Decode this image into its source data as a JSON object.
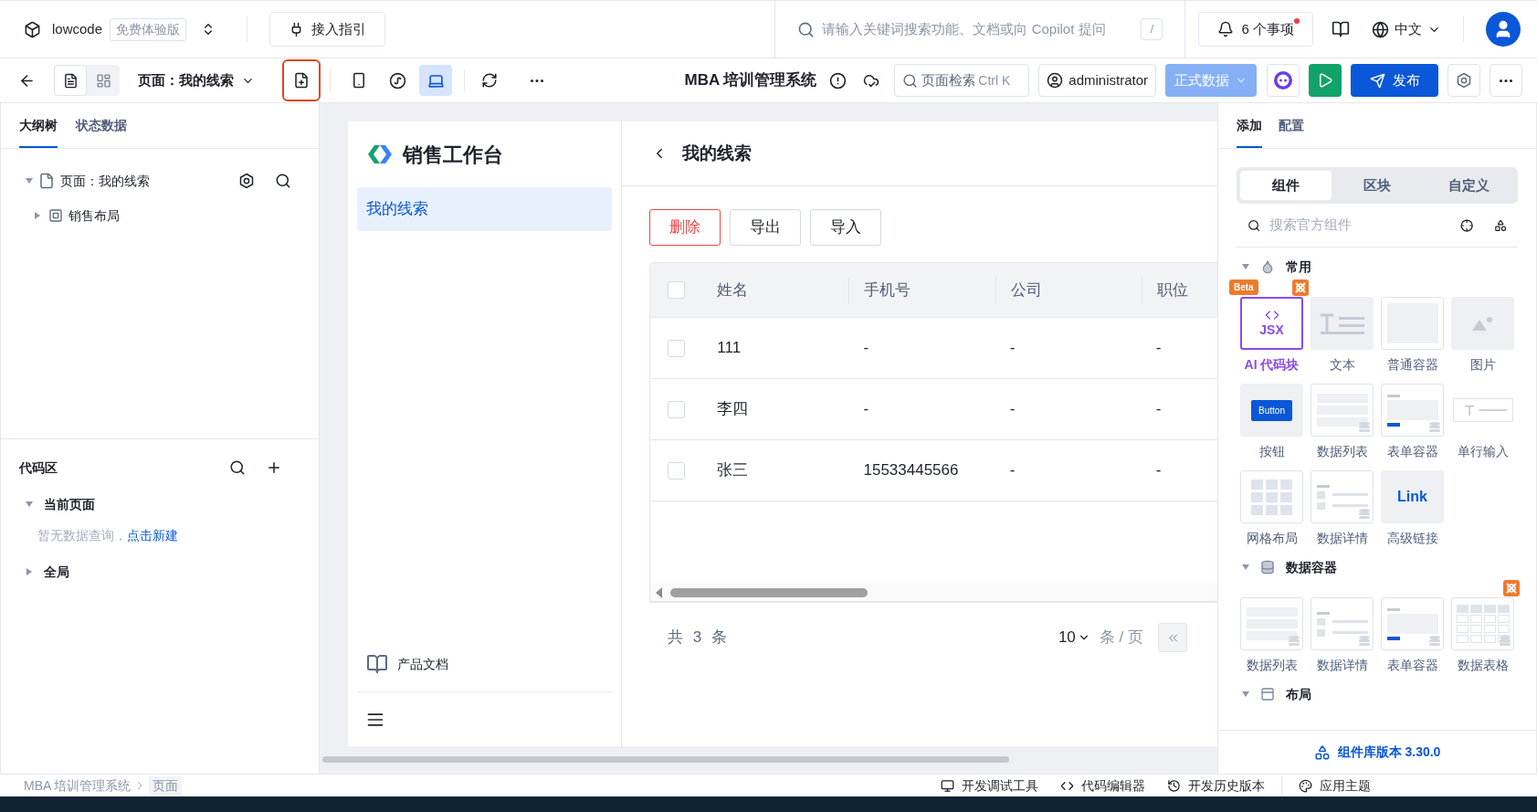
{
  "topbar": {
    "app_name": "lowcode",
    "plan_badge": "免费体验版",
    "guide_button": "接入指引",
    "search": {
      "placeholder": "请输入关键词搜索功能、文档或向 Copilot 提问",
      "shortcut": "/"
    },
    "notifications": {
      "label": "6 个事项",
      "unread": true
    },
    "language": "中文"
  },
  "toolbar": {
    "view_modes": [
      {
        "kind": "outline",
        "selected": true
      },
      {
        "kind": "layout",
        "selected": false
      }
    ],
    "page_selector": "页面：我的线索",
    "new_page_highlighted": true,
    "devices": [
      {
        "kind": "mobile",
        "selected": false
      },
      {
        "kind": "miniapp",
        "selected": false
      },
      {
        "kind": "desktop",
        "selected": true
      }
    ],
    "app_title": "MBA 培训管理系统",
    "page_search": {
      "placeholder": "页面检索",
      "shortcut": "Ctrl K"
    },
    "user": "administrator",
    "data_mode": "正式数据",
    "publish": "发布"
  },
  "left_panel": {
    "tabs": [
      {
        "label": "大纲树",
        "selected": true
      },
      {
        "label": "状态数据",
        "selected": false
      }
    ],
    "tree": [
      {
        "label": "页面：我的线索",
        "kind": "page",
        "expanded": true,
        "children": [
          {
            "label": "销售布局",
            "kind": "layout",
            "expanded": false
          }
        ]
      }
    ],
    "code_area": {
      "title": "代码区",
      "groups": [
        {
          "label": "当前页面",
          "expanded": true,
          "empty_text": "暂无数据查询，",
          "create_link": "点击新建"
        },
        {
          "label": "全局",
          "expanded": false
        }
      ]
    }
  },
  "canvas": {
    "app": {
      "brand": "销售工作台",
      "nav": [
        {
          "label": "我的线索",
          "selected": true
        }
      ],
      "docs_link": "产品文档"
    },
    "page": {
      "title": "我的线索",
      "actions": [
        {
          "label": "删除",
          "kind": "danger"
        },
        {
          "label": "导出",
          "kind": "default"
        },
        {
          "label": "导入",
          "kind": "default"
        }
      ],
      "table": {
        "header_checked": false,
        "columns": [
          "姓名",
          "手机号",
          "公司",
          "职位"
        ],
        "rows": [
          {
            "checked": false,
            "cells": [
              "111",
              "-",
              "-",
              "-"
            ]
          },
          {
            "checked": false,
            "cells": [
              "李四",
              "-",
              "-",
              "-"
            ]
          },
          {
            "checked": false,
            "cells": [
              "张三",
              "15533445566",
              "-",
              "-"
            ]
          }
        ]
      },
      "pagination": {
        "total": "共 3 条",
        "page_size": "10",
        "unit": "条 / 页"
      }
    }
  },
  "right_panel": {
    "tabs": [
      {
        "label": "添加",
        "selected": true
      },
      {
        "label": "配置",
        "selected": false
      }
    ],
    "segments": [
      {
        "label": "组件",
        "selected": true
      },
      {
        "label": "区块",
        "selected": false
      },
      {
        "label": "自定义",
        "selected": false
      }
    ],
    "search_placeholder": "搜索官方组件",
    "sections": [
      {
        "title": "常用",
        "expanded": true,
        "items": [
          {
            "label": "AI 代码块",
            "kind": "jsx",
            "thumb_text": "JSX",
            "badge": "Beta",
            "hot": true
          },
          {
            "label": "文本",
            "kind": "text",
            "hot": false
          },
          {
            "label": "普通容器",
            "kind": "container",
            "hot": false
          },
          {
            "label": "图片",
            "kind": "image",
            "hot": false
          },
          {
            "label": "按钮",
            "kind": "button",
            "thumb_text": "Button",
            "hot": false
          },
          {
            "label": "数据列表",
            "kind": "list",
            "hot": false
          },
          {
            "label": "表单容器",
            "kind": "form",
            "hot": false
          },
          {
            "label": "单行输入",
            "kind": "input",
            "hot": false
          },
          {
            "label": "网格布局",
            "kind": "grid",
            "hot": false
          },
          {
            "label": "数据详情",
            "kind": "detail",
            "hot": false
          },
          {
            "label": "高级链接",
            "kind": "link",
            "thumb_text": "Link",
            "hot": false
          }
        ]
      },
      {
        "title": "数据容器",
        "expanded": true,
        "items": [
          {
            "label": "数据列表",
            "kind": "list",
            "hot": false
          },
          {
            "label": "数据详情",
            "kind": "detail",
            "hot": false
          },
          {
            "label": "表单容器",
            "kind": "form",
            "hot": false
          },
          {
            "label": "数据表格",
            "kind": "table",
            "hot": true
          }
        ]
      },
      {
        "title": "布局",
        "expanded": true
      }
    ],
    "footer": "组件库版本 3.30.0"
  },
  "status_bar": {
    "breadcrumb": [
      "MBA 培训管理系统",
      "页面"
    ],
    "tools": [
      {
        "label": "开发调试工具",
        "kind": "debug"
      },
      {
        "label": "代码编辑器",
        "kind": "code"
      },
      {
        "label": "开发历史版本",
        "kind": "history"
      },
      {
        "label": "应用主题",
        "kind": "theme"
      }
    ]
  }
}
